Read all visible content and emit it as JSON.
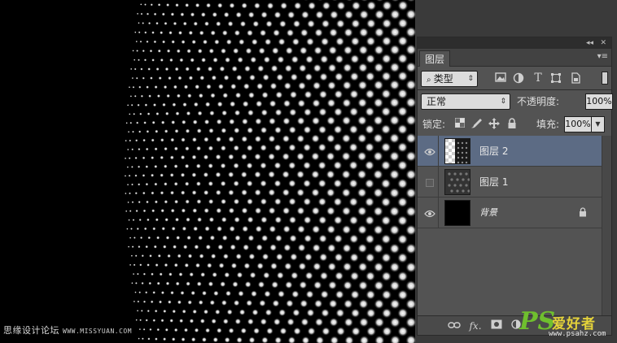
{
  "panel": {
    "tab_label": "图层",
    "filter": {
      "label": "类型",
      "icons": [
        "image-filter-icon",
        "adjustment-filter-icon",
        "type-filter-icon",
        "shape-filter-icon",
        "smart-object-filter-icon",
        "filter-toggle-icon"
      ],
      "type_icon_glyph": "T"
    },
    "blend_mode": "正常",
    "opacity_label": "不透明度:",
    "opacity_value": "100%",
    "lock_label": "锁定:",
    "fill_label": "填充:",
    "fill_value": "100%",
    "layers": [
      {
        "name": "图层 2",
        "visible": true,
        "selected": true
      },
      {
        "name": "图层 1",
        "visible": false,
        "selected": false
      },
      {
        "name": "背景",
        "visible": true,
        "selected": false,
        "locked": true
      }
    ],
    "bottom_icons": [
      "link-icon",
      "fx-icon",
      "mask-icon",
      "adjustment-icon",
      "group-icon",
      "new-layer-icon",
      "trash-icon"
    ],
    "fx_label": "fx."
  },
  "watermarks": {
    "left_text": "思缘设计论坛",
    "left_url": "WWW.MISSYUAN.COM",
    "right_ps": "PS",
    "right_cn": "爱好者",
    "right_site": "www.psahz.com"
  },
  "colors": {
    "panel_bg": "#535353",
    "selected_layer": "#5c6b84",
    "watermark_green": "#6fbf2e",
    "watermark_yellow": "#e4d23a"
  }
}
